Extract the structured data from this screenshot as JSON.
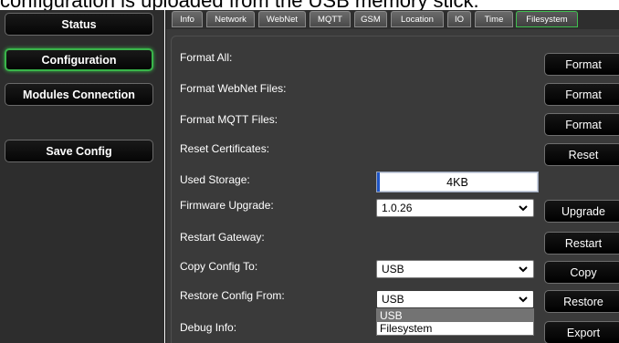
{
  "caption": "configuration is uploaded from the USB memory stick.",
  "sidebar": {
    "items": [
      {
        "label": "Status"
      },
      {
        "label": "Configuration"
      },
      {
        "label": "Modules Connection"
      },
      {
        "label": "Save Config"
      }
    ]
  },
  "tabs": [
    {
      "label": "Info"
    },
    {
      "label": "Network"
    },
    {
      "label": "WebNet"
    },
    {
      "label": "MQTT"
    },
    {
      "label": "GSM"
    },
    {
      "label": "Location"
    },
    {
      "label": "IO"
    },
    {
      "label": "Time"
    },
    {
      "label": "Filesystem"
    }
  ],
  "active_tab": "Filesystem",
  "rows": {
    "format_all": {
      "label": "Format All:",
      "button": "Format"
    },
    "format_webnet": {
      "label": "Format WebNet Files:",
      "button": "Format"
    },
    "format_mqtt": {
      "label": "Format MQTT Files:",
      "button": "Format"
    },
    "reset_certs": {
      "label": "Reset Certificates:",
      "button": "Reset"
    },
    "used_storage": {
      "label": "Used Storage:",
      "value": "4KB"
    },
    "firmware": {
      "label": "Firmware Upgrade:",
      "selected": "1.0.26",
      "button": "Upgrade"
    },
    "restart": {
      "label": "Restart Gateway:",
      "button": "Restart"
    },
    "copy_config": {
      "label": "Copy Config To:",
      "selected": "USB",
      "button": "Copy"
    },
    "restore_config": {
      "label": "Restore Config From:",
      "selected": "USB",
      "button": "Restore"
    },
    "debug": {
      "label": "Debug Info:",
      "button": "Export"
    }
  },
  "restore_dropdown": {
    "options": [
      {
        "label": "USB"
      },
      {
        "label": "Filesystem"
      }
    ]
  },
  "colors": {
    "active_border": "#39b54a",
    "panel_bg": "#3a3a3a",
    "sidebar_bg": "#2d2d2d"
  }
}
